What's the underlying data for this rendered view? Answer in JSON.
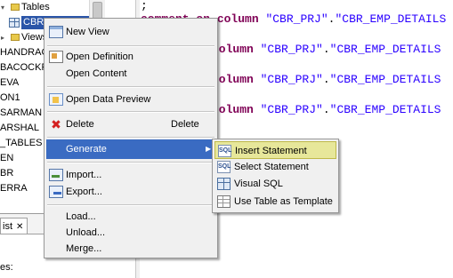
{
  "tree": {
    "tables_label": "Tables",
    "selected_label": "CBR_EMP_DE",
    "views_label": "Views",
    "items": [
      "HANDRAG",
      "BACOCKPI",
      "EVA",
      "ON1",
      "SARMAN",
      "ARSHAL",
      "_TABLES",
      "EN",
      "BR",
      "ERRA"
    ]
  },
  "bottom_panel": {
    "tab_label": "ist",
    "close_glyph": "✕",
    "label": "es:"
  },
  "editor": {
    "line0": ";",
    "line1": {
      "kw": "comment on column",
      "s1": "\"CBR_PRJ\"",
      "dot": ".",
      "s2": "\"CBR_EMP_DETAILS"
    },
    "line2": {
      "kw": "column",
      "s1": "\"CBR_PRJ\"",
      "dot": ".",
      "s2": "\"CBR_EMP_DETAILS"
    },
    "line3": {
      "kw": "column",
      "s1": "\"CBR_PRJ\"",
      "dot": ".",
      "s2": "\"CBR_EMP_DETAILS"
    },
    "line4": {
      "kw": "column",
      "s1": "\"CBR_PRJ\"",
      "dot": ".",
      "s2": "\"CBR_EMP_DETAILS"
    }
  },
  "context_menu": {
    "new_view": "New View",
    "open_definition": "Open Definition",
    "open_content": "Open Content",
    "open_data_preview": "Open Data Preview",
    "delete": "Delete",
    "delete_shortcut": "Delete",
    "generate": "Generate",
    "import": "Import...",
    "export": "Export...",
    "load": "Load...",
    "unload": "Unload...",
    "merge": "Merge..."
  },
  "submenu": {
    "insert_statement": "Insert Statement",
    "select_statement": "Select Statement",
    "visual_sql": "Visual SQL",
    "use_table_as_template": "Use Table as Template"
  },
  "icons": {
    "sql_glyph": "SQL",
    "delete_glyph": "✖",
    "submenu_arrow": "▶"
  },
  "colors": {
    "selection": "#2a55a8",
    "menu_highlight": "#3a6bc2",
    "submenu_hover": "#e7e79a",
    "keyword": "#7f0055",
    "string": "#2a00ff"
  }
}
